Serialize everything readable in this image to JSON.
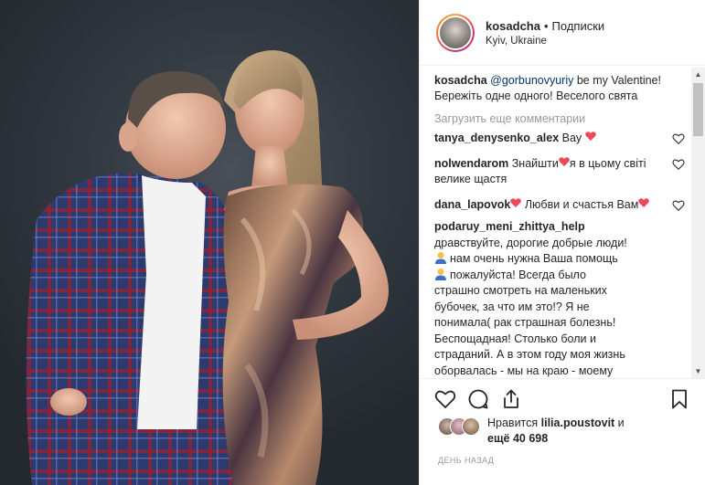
{
  "post": {
    "username": "kosadcha",
    "separator": "•",
    "follow_label": "Подписки",
    "location": "Kyiv, Ukraine"
  },
  "caption": {
    "username": "kosadcha",
    "mention": "@gorbunovyuriy",
    "text_after_mention": " be my Valentine!",
    "line2": "Бережіть одне одного! Веселого свята"
  },
  "load_more_label": "Загрузить еще комментарии",
  "comments": [
    {
      "user": "tanya_denysenko_alex",
      "text": " Вау"
    },
    {
      "user": "nolwendarom",
      "text": " Знайшти",
      "text2": "я в цьому світі велике щастя"
    },
    {
      "user": "dana_lapovok",
      "text": " Любви и счастья Вам"
    },
    {
      "user": "podaruy_meni_zhittya_help",
      "line1": "дравствуйте, дорогие добрые люди!",
      "line2": "нам очень нужна Ваша помощь",
      "line3": "пожалуйста! Всегда было",
      "line4": "страшно смотреть на маленьких",
      "line5": "бубочек, за что им это!? Я не",
      "line6": "понимала( рак страшная болезнь!",
      "line7": "Беспощадная! Столько боли и",
      "line8": "страданий. А в этом году моя жизнь",
      "line9": "оборвалась - мы на краю - моему"
    }
  ],
  "likes": {
    "prefix": "Нравится ",
    "user": "lilia.poustovit",
    "suffix": " и",
    "line2_prefix": "ещё ",
    "count": "40 698"
  },
  "timestamp": "ДЕНЬ НАЗАД",
  "icons": {
    "like": "heart-icon",
    "comment": "comment-bubble-icon",
    "share": "share-icon",
    "save": "bookmark-icon"
  },
  "colors": {
    "mention": "#003569",
    "muted": "#999999",
    "text": "#262626",
    "heart_red": "#ed4956"
  }
}
